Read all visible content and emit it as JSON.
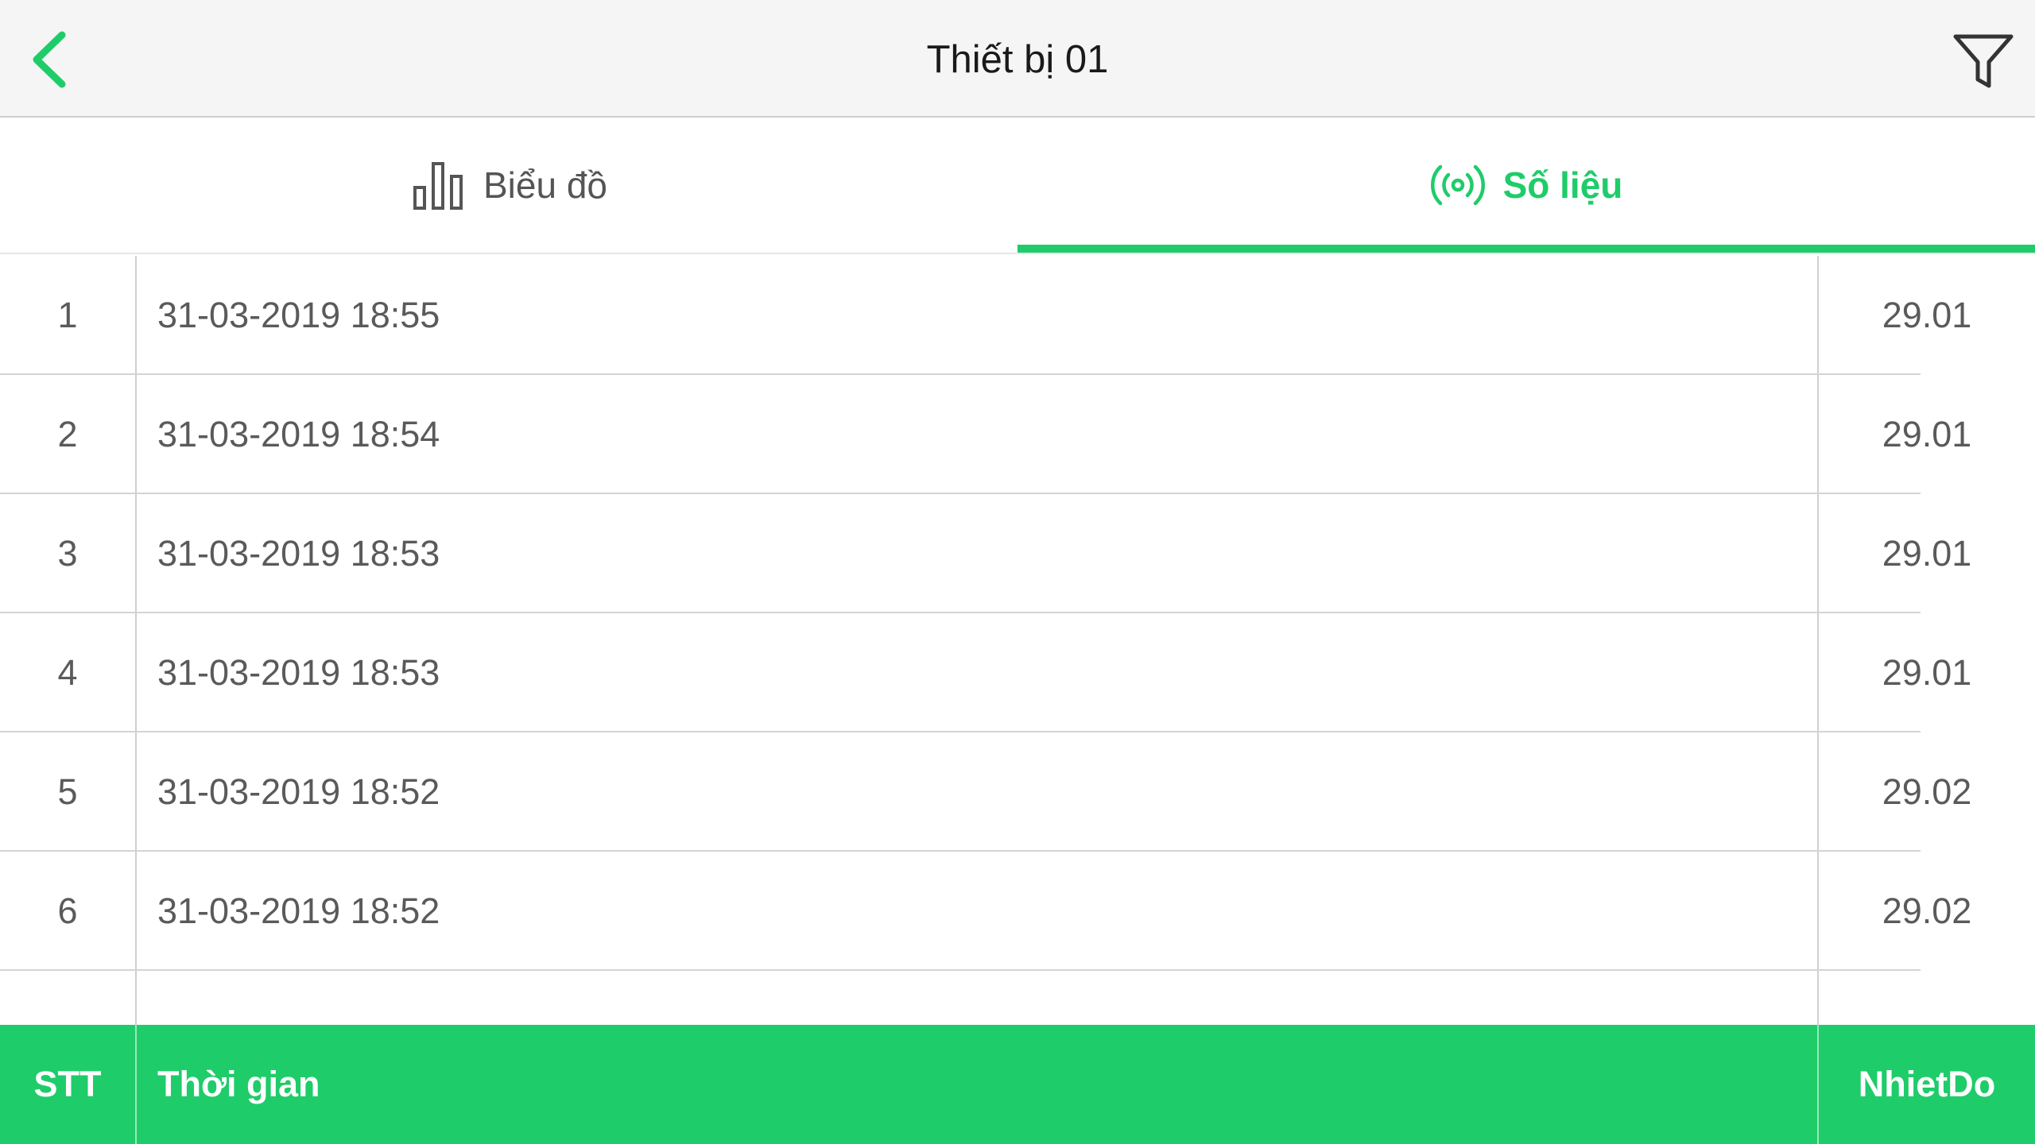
{
  "header": {
    "title": "Thiết bị 01",
    "back_icon": "chevron-left-icon",
    "filter_icon": "filter-icon",
    "accent_color": "#1fcc6a"
  },
  "tabs": [
    {
      "label": "Biểu đồ",
      "icon": "bar-chart-icon",
      "active": false
    },
    {
      "label": "Số liệu",
      "icon": "broadcast-icon",
      "active": true
    }
  ],
  "table": {
    "columns": [
      "STT",
      "Thời gian",
      "NhietDo"
    ],
    "rows": [
      {
        "stt": "1",
        "time": "31-03-2019 18:55",
        "value": "29.01"
      },
      {
        "stt": "2",
        "time": "31-03-2019 18:54",
        "value": "29.01"
      },
      {
        "stt": "3",
        "time": "31-03-2019 18:53",
        "value": "29.01"
      },
      {
        "stt": "4",
        "time": "31-03-2019 18:53",
        "value": "29.01"
      },
      {
        "stt": "5",
        "time": "31-03-2019 18:52",
        "value": "29.02"
      },
      {
        "stt": "6",
        "time": "31-03-2019 18:52",
        "value": "29.02"
      }
    ]
  }
}
